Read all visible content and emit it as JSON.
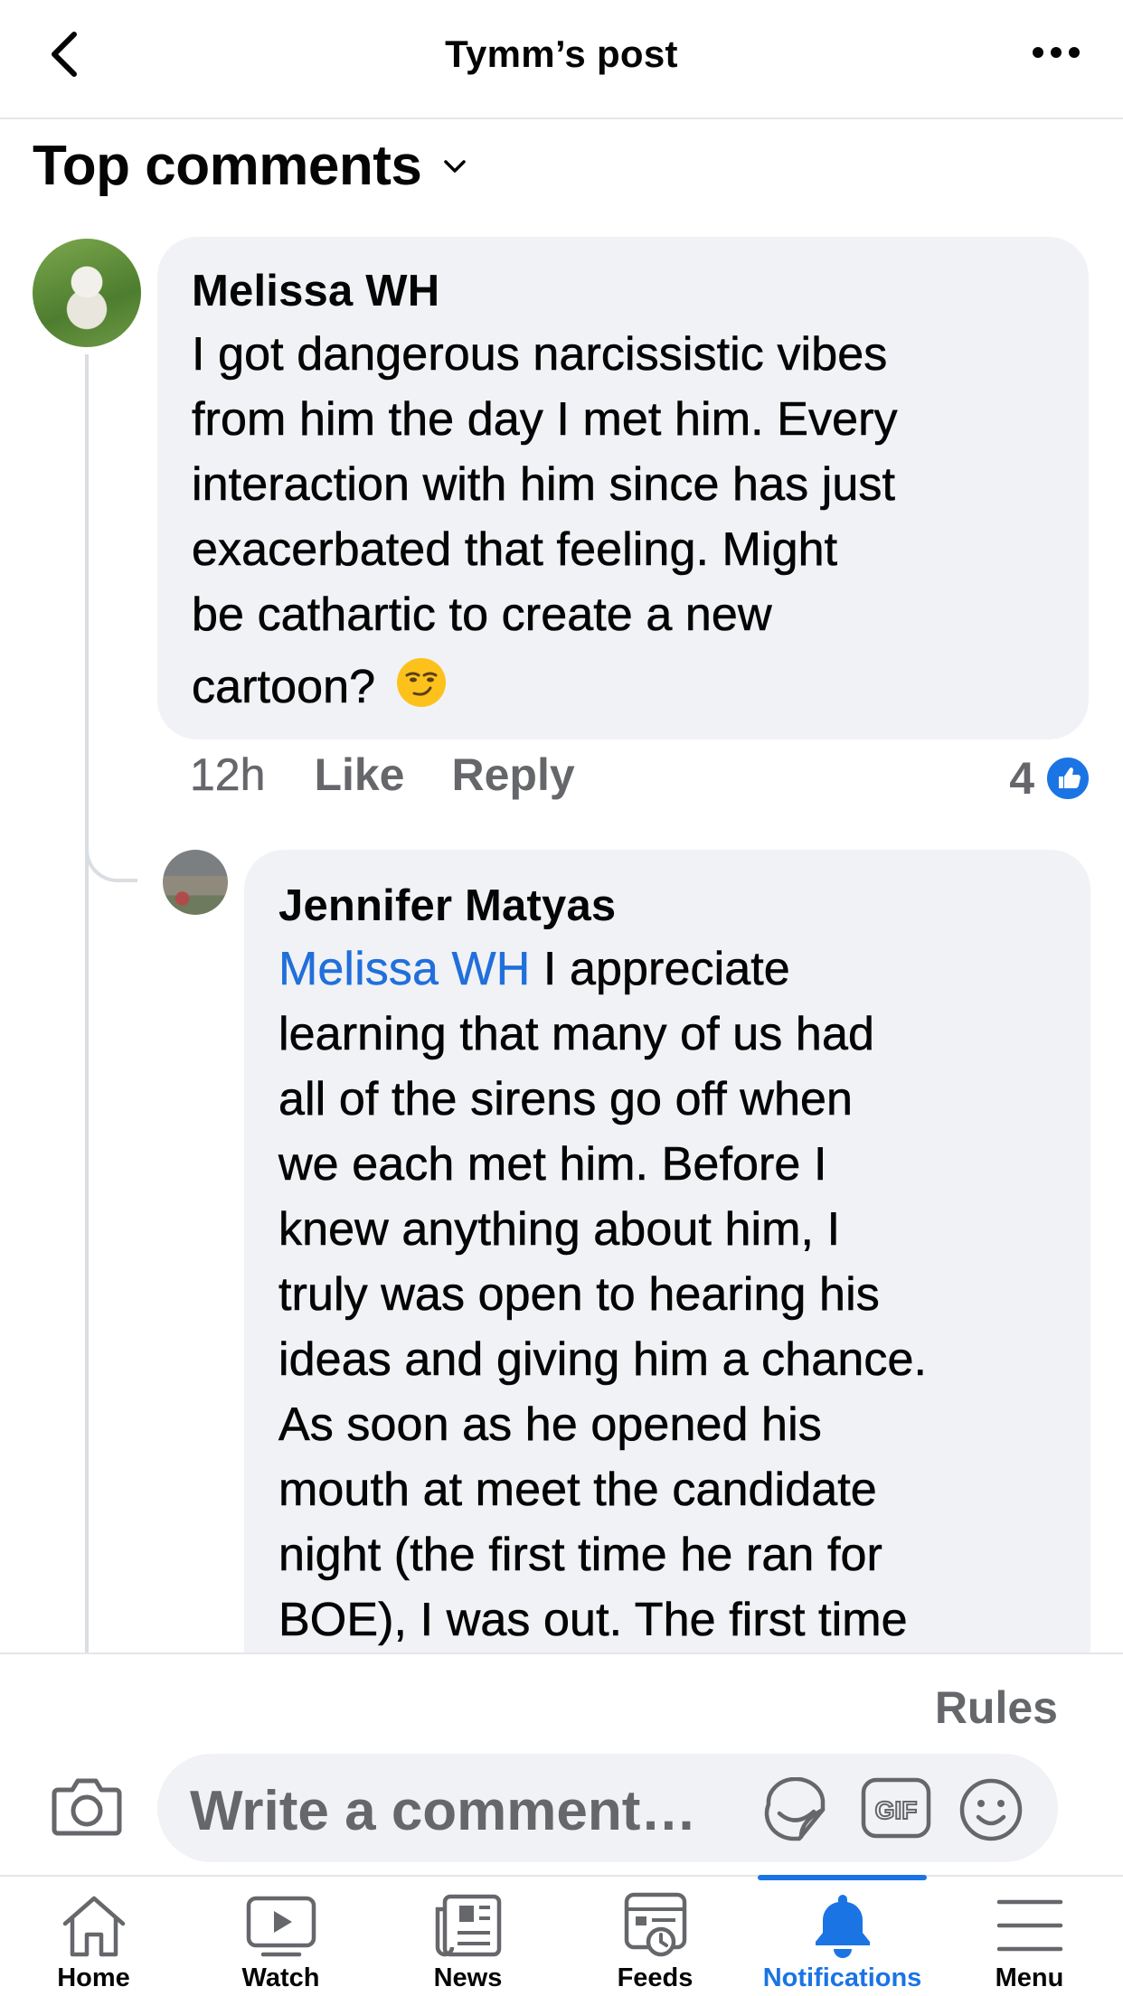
{
  "header": {
    "title": "Tymm’s post",
    "back_icon": "chevron-left-icon",
    "more_icon": "more-horizontal-icon"
  },
  "sort": {
    "label": "Top comments"
  },
  "comments": [
    {
      "author": "Melissa WH",
      "lines": [
        "I got dangerous narcissistic vibes",
        "from him the day I met him.  Every",
        "interaction with him since has just",
        "exacerbated that feeling. Might",
        "be cathartic to create a new",
        "cartoon?"
      ],
      "emoji": "smirking-face-emoji",
      "time": "12h",
      "like_label": "Like",
      "reply_label": "Reply",
      "reaction_count": "4"
    },
    {
      "author": "Jennifer Matyas",
      "mention": "Melissa WH",
      "lines": [
        " I appreciate",
        "learning that many of us had",
        "all of the sirens go off  when",
        "we each met him.  Before I",
        "knew anything about him, I",
        "truly was open to hearing his",
        "ideas and giving him a chance.",
        "As soon as he opened his",
        "mouth at meet the candidate",
        "night (the first time he ran for",
        "BOE), I was out.  The first time"
      ]
    }
  ],
  "composer": {
    "rules_label": "Rules",
    "placeholder": "Write a comment…"
  },
  "tabs": [
    {
      "label": "Home",
      "icon": "home-icon"
    },
    {
      "label": "Watch",
      "icon": "video-icon"
    },
    {
      "label": "News",
      "icon": "newspaper-icon"
    },
    {
      "label": "Feeds",
      "icon": "feeds-icon"
    },
    {
      "label": "Notifications",
      "icon": "bell-icon",
      "active": true
    },
    {
      "label": "Menu",
      "icon": "menu-icon"
    }
  ],
  "colors": {
    "accent": "#1b74e4",
    "mention": "#216fdb",
    "bubble": "#f0f2f5",
    "secondary_text": "#65676b"
  }
}
